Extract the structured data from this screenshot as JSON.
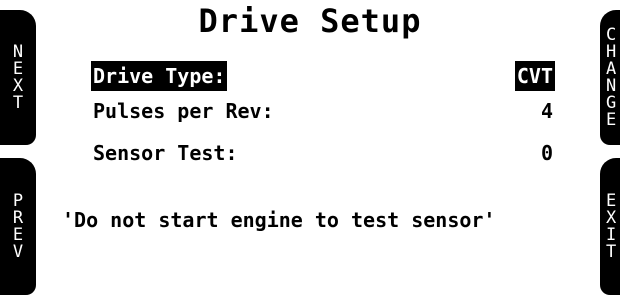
{
  "title": "Drive Setup",
  "buttons": {
    "left_top": [
      "N",
      "E",
      "X",
      "T"
    ],
    "left_bottom": [
      "P",
      "R",
      "E",
      "V"
    ],
    "right_top": [
      "C",
      "H",
      "A",
      "N",
      "G",
      "E"
    ],
    "right_bottom": [
      "E",
      "X",
      "I",
      "T"
    ]
  },
  "fields": [
    {
      "label": "Drive Type:",
      "value": "CVT",
      "selected": true
    },
    {
      "label": "Pulses per Rev:",
      "value": "4",
      "selected": false
    },
    {
      "label": "Sensor Test:",
      "value": "0",
      "selected": false
    }
  ],
  "message": "'Do not start engine to test sensor'"
}
